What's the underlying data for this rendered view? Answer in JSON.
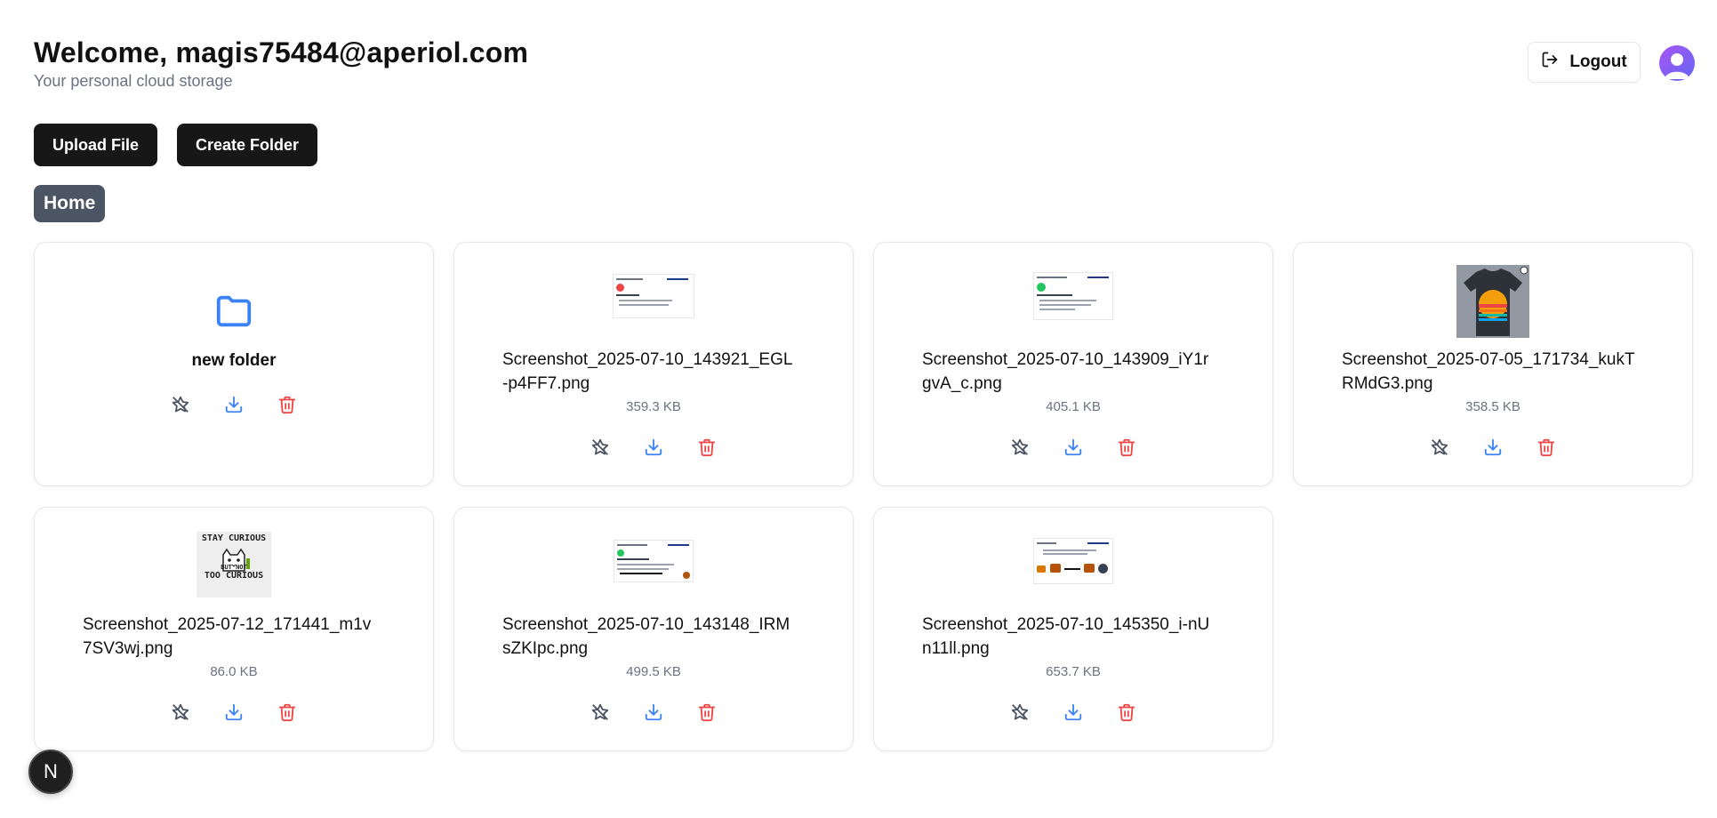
{
  "header": {
    "welcome": "Welcome, magis75484@aperiol.com",
    "subtitle": "Your personal cloud storage",
    "logout_label": "Logout"
  },
  "toolbar": {
    "upload_label": "Upload File",
    "create_folder_label": "Create Folder"
  },
  "breadcrumb": {
    "home_label": "Home"
  },
  "items": [
    {
      "type": "folder",
      "name": "new folder",
      "icon": "folder-icon"
    },
    {
      "type": "file",
      "name": "Screenshot_2025-07-10_143921_EGL-p4FF7.png",
      "size": "359.3 KB",
      "thumb": "slide-red"
    },
    {
      "type": "file",
      "name": "Screenshot_2025-07-10_143909_iY1rgvA_c.png",
      "size": "405.1 KB",
      "thumb": "slide-green"
    },
    {
      "type": "file",
      "name": "Screenshot_2025-07-05_171734_kukTRMdG3.png",
      "size": "358.5 KB",
      "thumb": "tshirt"
    },
    {
      "type": "file",
      "name": "Screenshot_2025-07-12_171441_m1v7SV3wj.png",
      "size": "86.0 KB",
      "thumb": "cat-stay-curious",
      "thumb_text_top": "STAY CURIOUS",
      "thumb_text_mid": "BUT NOT",
      "thumb_text_bottom": "TOO CURIOUS"
    },
    {
      "type": "file",
      "name": "Screenshot_2025-07-10_143148_IRMsZKIpc.png",
      "size": "499.5 KB",
      "thumb": "slide-green"
    },
    {
      "type": "file",
      "name": "Screenshot_2025-07-10_145350_i-nUn11ll.png",
      "size": "653.7 KB",
      "thumb": "slide-arrow"
    }
  ],
  "colors": {
    "primary_button": "#171717",
    "breadcrumb_bg": "#4b5563",
    "folder_blue": "#3b82f6",
    "download_blue": "#3b82f6",
    "delete_red": "#ef4444",
    "unstar_gray": "#4b5563"
  },
  "badge": {
    "label": "N"
  }
}
